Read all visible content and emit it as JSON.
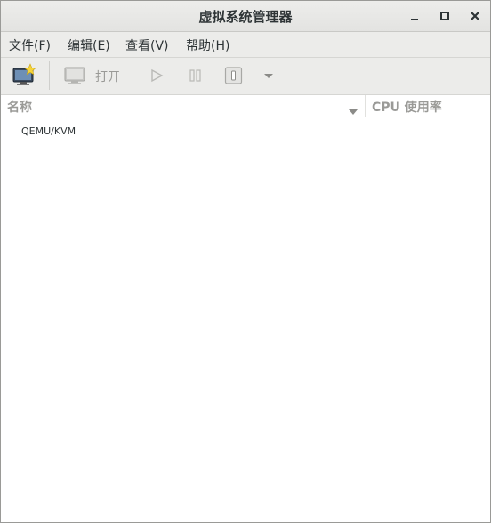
{
  "window": {
    "title": "虚拟系统管理器"
  },
  "menu": {
    "items": [
      {
        "label": "文件(F)"
      },
      {
        "label": "编辑(E)"
      },
      {
        "label": "查看(V)"
      },
      {
        "label": "帮助(H)"
      }
    ]
  },
  "toolbar": {
    "new_vm_icon": "new-vm-icon",
    "console_icon": "monitor-icon",
    "open_label": "打开",
    "run_icon": "play-icon",
    "pause_icon": "pause-icon",
    "shutdown_icon": "power-icon",
    "shutdown_menu_icon": "chevron-down-icon"
  },
  "columns": {
    "name": "名称",
    "cpu": "CPU 使用率"
  },
  "connections": [
    {
      "name": "QEMU/KVM"
    }
  ],
  "colors": {
    "titlebar": "#e6e6e4",
    "toolbar": "#ececea",
    "disabled_text": "#9a9a97",
    "text": "#2e3436"
  }
}
